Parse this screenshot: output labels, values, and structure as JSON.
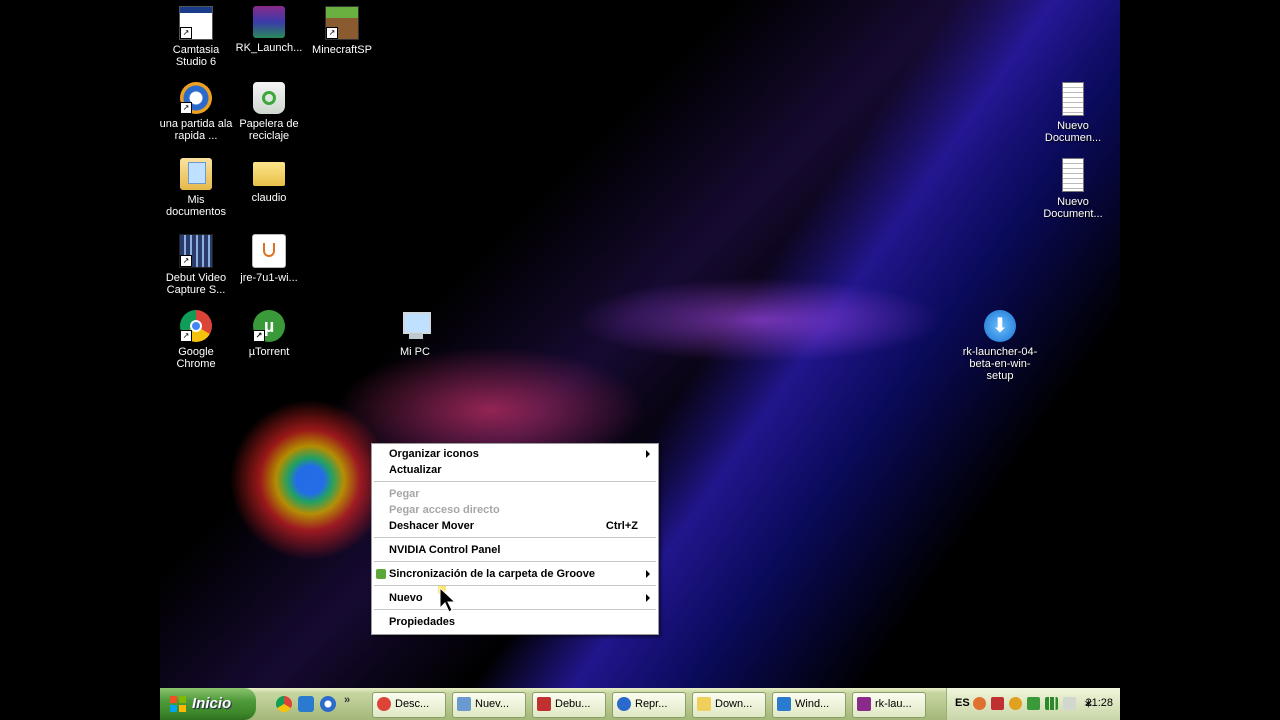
{
  "desktop": {
    "icons": [
      {
        "label": "Camtasia Studio 6",
        "icon": "camtasia-icon",
        "color": "#1a3a8a"
      },
      {
        "label": "RK_Launch...",
        "icon": "winrar-icon",
        "color": "#8a2a8a"
      },
      {
        "label": "MinecraftSP",
        "icon": "minecraft-icon",
        "color": "#5a8a30"
      },
      {
        "label": "una partida ala rapida ...",
        "icon": "media-player-icon",
        "color": "#2a6acc"
      },
      {
        "label": "Papelera de reciclaje",
        "icon": "recycle-bin-icon",
        "color": "#3aa83a"
      },
      {
        "label": "Mis documentos",
        "icon": "my-documents-icon",
        "color": "#e6c25a"
      },
      {
        "label": "claudio",
        "icon": "folder-icon",
        "color": "#f0cf5a"
      },
      {
        "label": "Debut Video Capture S...",
        "icon": "debut-video-icon",
        "color": "#4a6ab0"
      },
      {
        "label": "jre-7u1-wi...",
        "icon": "java-icon",
        "color": "#e07020"
      },
      {
        "label": "Google Chrome",
        "icon": "chrome-icon",
        "color": "#db4437"
      },
      {
        "label": "µTorrent",
        "icon": "utorrent-icon",
        "color": "#3a9a3a"
      },
      {
        "label": "Mi PC",
        "icon": "my-computer-icon",
        "color": "#6a9ad0"
      },
      {
        "label": "Nuevo Documen...",
        "icon": "text-document-icon",
        "color": "#ffffff"
      },
      {
        "label": "Nuevo Document...",
        "icon": "text-document-icon",
        "color": "#ffffff"
      },
      {
        "label": "rk-launcher-04-beta-en-win-setup",
        "icon": "download-setup-icon",
        "color": "#2a8ae0"
      }
    ]
  },
  "context_menu": {
    "items": {
      "organizar": {
        "label": "Organizar iconos"
      },
      "actualizar": {
        "label": "Actualizar"
      },
      "pegar": {
        "label": "Pegar"
      },
      "pegar_acceso": {
        "label": "Pegar acceso directo"
      },
      "deshacer": {
        "label": "Deshacer Mover",
        "shortcut": "Ctrl+Z"
      },
      "nvidia": {
        "label": "NVIDIA Control Panel"
      },
      "groove": {
        "label": "Sincronización de la carpeta de Groove"
      },
      "nuevo": {
        "label": "Nuevo"
      },
      "propiedades": {
        "label": "Propiedades"
      }
    }
  },
  "taskbar": {
    "start_label": "Inicio",
    "tasks": [
      {
        "label": "Desc...",
        "icon": "chrome-icon",
        "color": "#db4437"
      },
      {
        "label": "Nuev...",
        "icon": "notepad-icon",
        "color": "#6a9ad0"
      },
      {
        "label": "Debu...",
        "icon": "debut-video-icon",
        "color": "#c03030"
      },
      {
        "label": "Repr...",
        "icon": "media-player-icon",
        "color": "#2a6acc"
      },
      {
        "label": "Down...",
        "icon": "folder-icon",
        "color": "#f0cf5a"
      },
      {
        "label": "Wind...",
        "icon": "ie-icon",
        "color": "#2a7ad0"
      },
      {
        "label": "rk-lau...",
        "icon": "winrar-icon",
        "color": "#8a2a8a"
      }
    ],
    "tray": {
      "language": "ES",
      "clock": "21:28"
    }
  }
}
